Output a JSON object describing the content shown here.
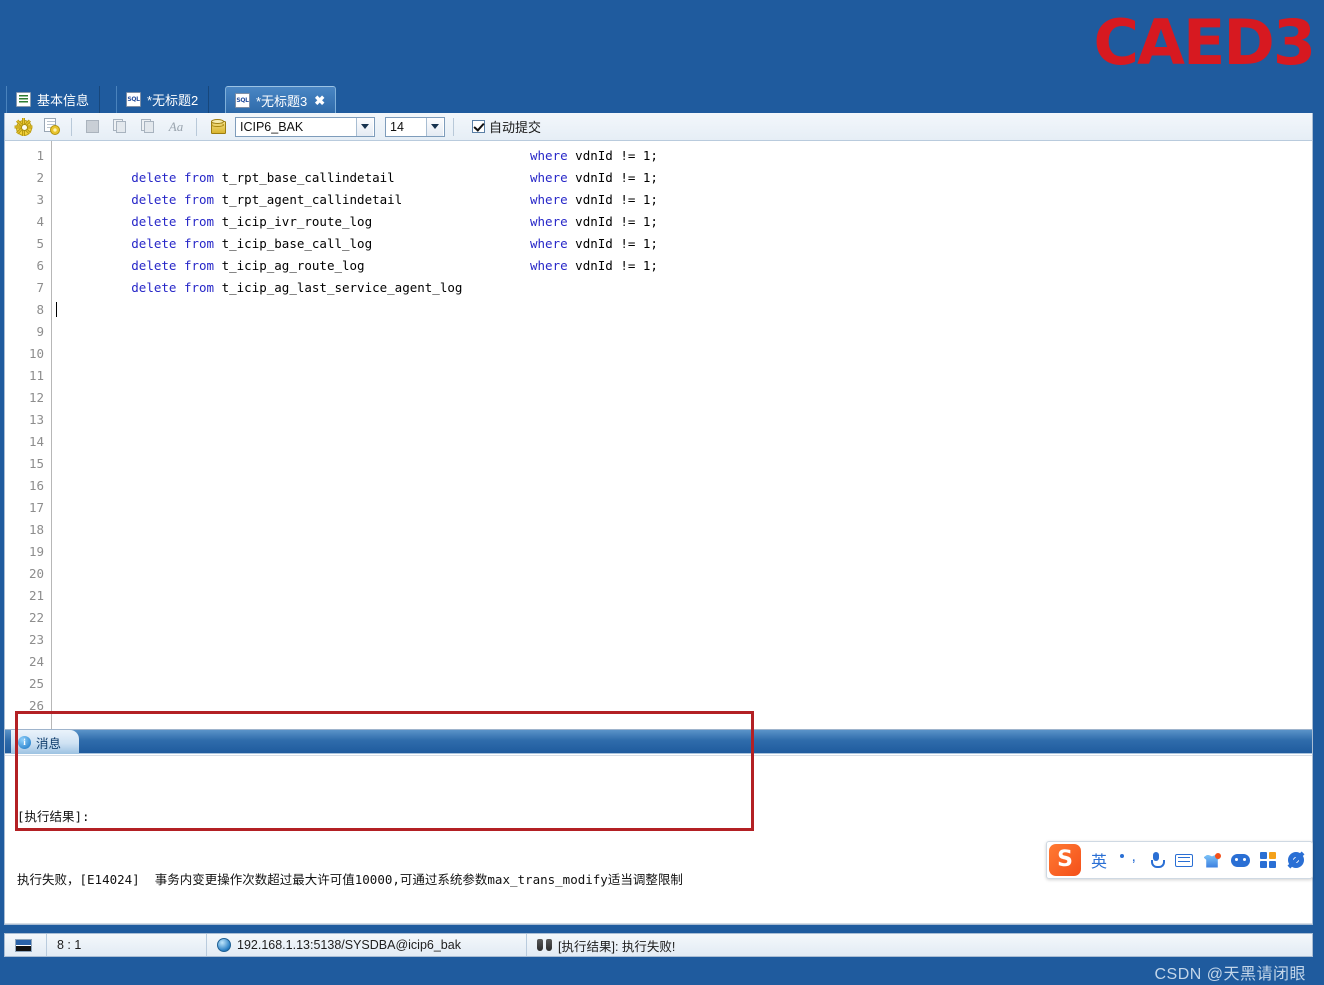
{
  "app": {
    "logo_text": "CAED3",
    "logo_color": "#d71920",
    "header_color": "#1f5b9e"
  },
  "tabs": [
    {
      "label": "基本信息",
      "icon": "document-icon",
      "active": false,
      "closable": false
    },
    {
      "label": "*无标题2",
      "icon": "sql-file-icon",
      "active": false,
      "closable": false
    },
    {
      "label": "*无标题3",
      "icon": "sql-file-icon",
      "active": true,
      "closable": true,
      "close_glyph": "✖"
    }
  ],
  "toolbar": {
    "buttons": [
      {
        "name": "settings-gear-icon",
        "title": "设置"
      },
      {
        "name": "gear-page-icon",
        "title": "执行配置"
      },
      {
        "name": "stop-icon",
        "title": "停止"
      },
      {
        "name": "copy-page-icon",
        "title": "复制"
      },
      {
        "name": "export-page-icon",
        "title": "导出"
      },
      {
        "name": "font-format-icon",
        "title": "Aa"
      },
      {
        "name": "database-icon",
        "title": "数据库"
      }
    ],
    "aa_label": "Aa",
    "database_combo": {
      "value": "ICIP6_BAK",
      "placeholder": "ICIP6_BAK"
    },
    "font_size_combo": {
      "value": "14",
      "placeholder": "14"
    },
    "auto_commit": {
      "label": "自动提交",
      "checked": true
    }
  },
  "editor": {
    "line_numbers": [
      1,
      2,
      3,
      4,
      5,
      6,
      7,
      8,
      9,
      10,
      11,
      12,
      13,
      14,
      15,
      16,
      17,
      18,
      19,
      20,
      21,
      22,
      23,
      24,
      25,
      26
    ],
    "cursor_line": 8,
    "lines": [
      {
        "n": 1,
        "kw1": "delete",
        "kw2": "from",
        "table": "t_rpt_base_callindetail",
        "kw3": "where",
        "cond": "vdnId != 1;"
      },
      {
        "n": 2,
        "kw1": "delete",
        "kw2": "from",
        "table": "t_rpt_agent_callindetail",
        "kw3": "where",
        "cond": "vdnId != 1;"
      },
      {
        "n": 3,
        "kw1": "delete",
        "kw2": "from",
        "table": "t_icip_ivr_route_log",
        "kw3": "where",
        "cond": "vdnId != 1;"
      },
      {
        "n": 4,
        "kw1": "delete",
        "kw2": "from",
        "table": "t_icip_base_call_log",
        "kw3": "where",
        "cond": "vdnId != 1;"
      },
      {
        "n": 5,
        "kw1": "delete",
        "kw2": "from",
        "table": "t_icip_ag_route_log",
        "kw3": "where",
        "cond": "vdnId != 1;"
      },
      {
        "n": 6,
        "kw1": "delete",
        "kw2": "from",
        "table": "t_icip_ag_last_service_agent_log",
        "kw3": "where",
        "cond": "vdnId != 1;"
      }
    ]
  },
  "message_panel": {
    "tab_label": "消息",
    "tab_icon": "info-icon",
    "line1": "[执行结果]:",
    "line2": "执行失败，[E14024]  事务内变更操作次数超过最大许可值10000,可通过系统参数max_trans_modify适当调整限制"
  },
  "annotation": {
    "color": "#b32024"
  },
  "statusbar": {
    "flag_icon": "keyboard-layout-icon",
    "position": "8 : 1",
    "globe_icon": "connection-icon",
    "connection": "192.168.1.13:5138/SYSDBA@icip6_bak",
    "result_icon": "binoculars-icon",
    "result": "[执行结果]: 执行失败!"
  },
  "ime": {
    "logo": "S",
    "items": [
      {
        "name": "language-mode-button",
        "label": "英"
      },
      {
        "name": "punctuation-icon",
        "label": ""
      },
      {
        "name": "microphone-icon",
        "label": ""
      },
      {
        "name": "keyboard-icon",
        "label": ""
      },
      {
        "name": "skin-icon",
        "label": ""
      },
      {
        "name": "emoji-icon",
        "label": ""
      },
      {
        "name": "apps-grid-icon",
        "label": ""
      },
      {
        "name": "settings-icon",
        "label": ""
      }
    ]
  },
  "watermark": {
    "text": "CSDN @天黑请闭眼"
  }
}
